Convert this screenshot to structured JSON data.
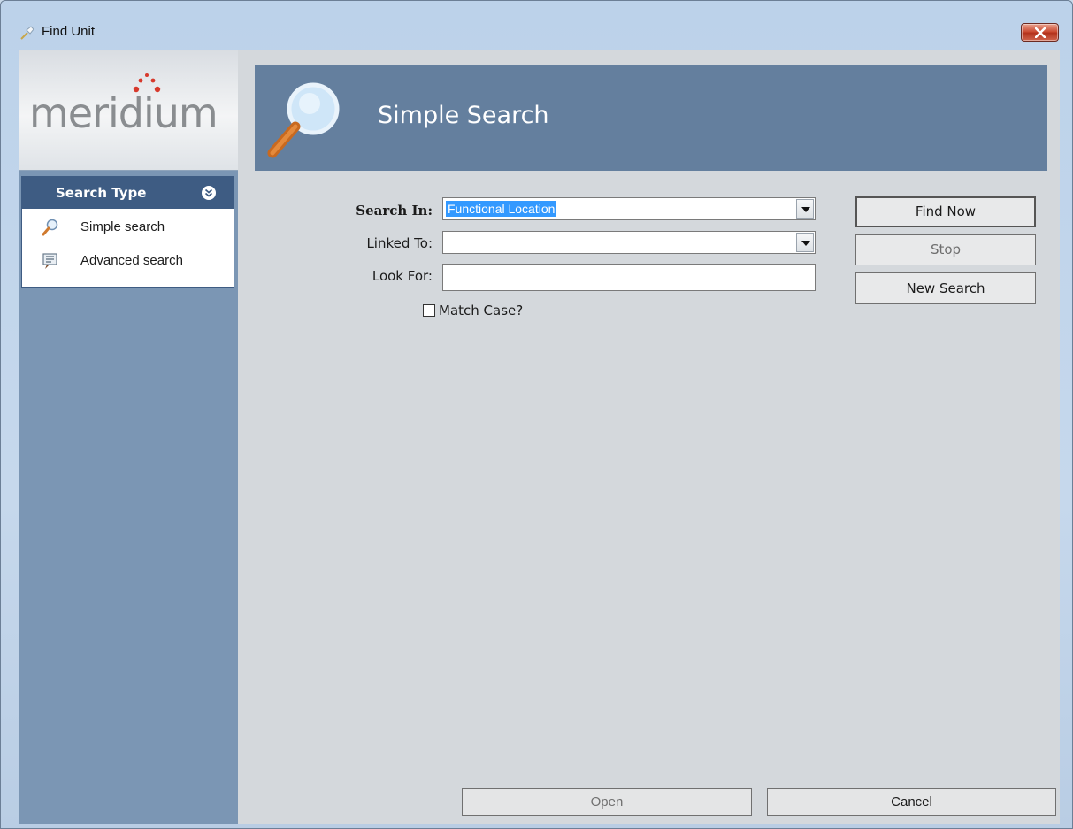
{
  "window": {
    "title": "Find Unit"
  },
  "logo": {
    "text": "meridium"
  },
  "sidebar": {
    "panel_title": "Search Type",
    "items": [
      {
        "label": "Simple search",
        "icon": "magnifier-icon"
      },
      {
        "label": "Advanced search",
        "icon": "advanced-search-icon"
      }
    ]
  },
  "banner": {
    "title": "Simple Search"
  },
  "form": {
    "search_in_label": "Search In:",
    "search_in_value": "Functional Location",
    "linked_to_label": "Linked To:",
    "linked_to_value": "",
    "look_for_label": "Look For:",
    "look_for_value": "",
    "match_case_label": "Match Case?",
    "match_case_checked": false
  },
  "actions": {
    "find_now": "Find Now",
    "stop": "Stop",
    "new_search": "New Search",
    "open": "Open",
    "cancel": "Cancel"
  },
  "colors": {
    "sidebar": "#7b96b4",
    "banner": "#647f9e",
    "panel_header": "#3e5c83",
    "selection": "#3399ff",
    "close_button": "#c8452c"
  }
}
